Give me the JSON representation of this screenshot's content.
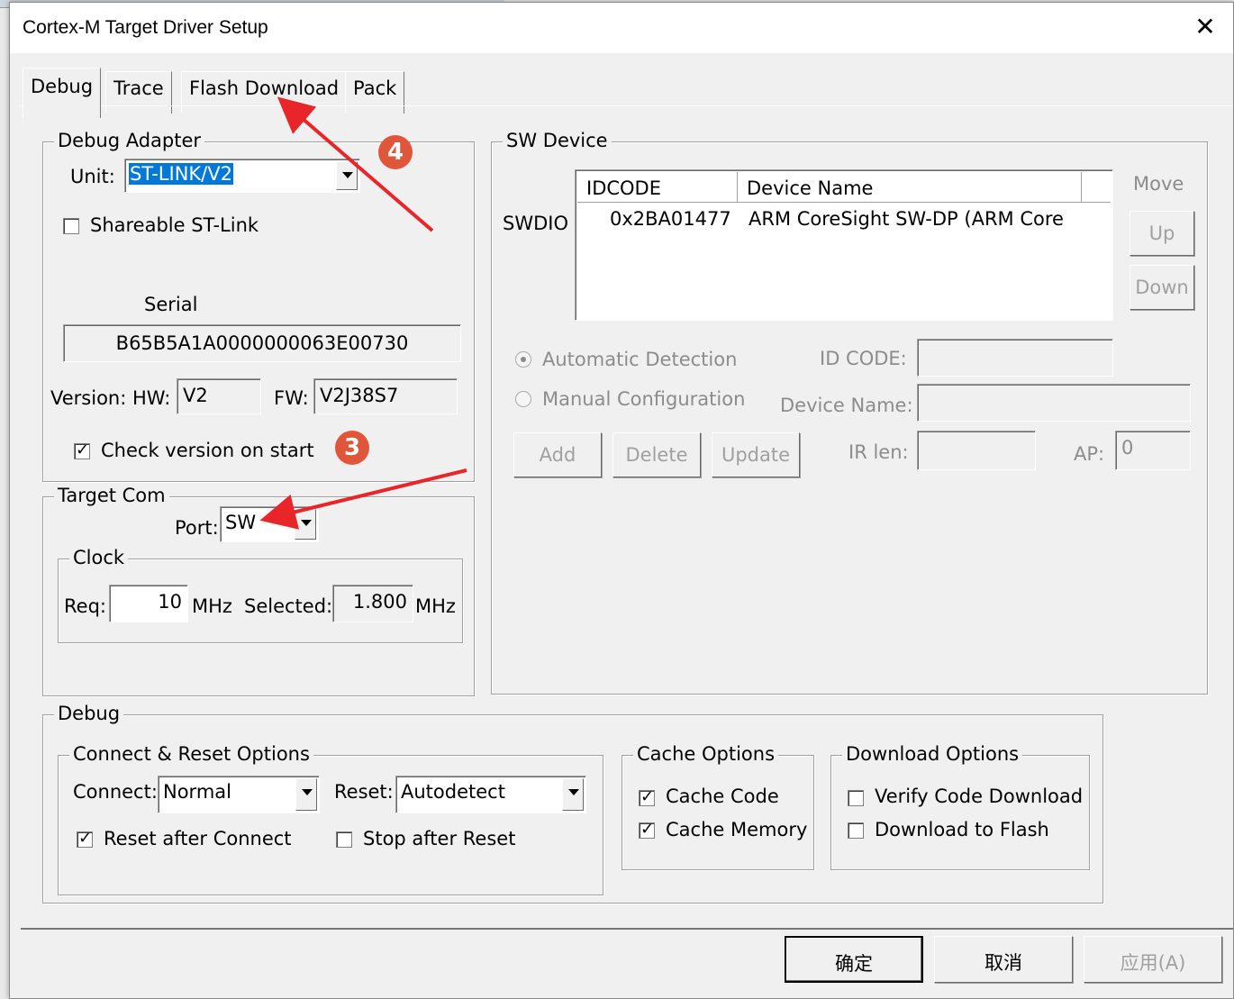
{
  "window": {
    "title": "Cortex-M Target Driver Setup"
  },
  "tabs": [
    {
      "label": "Debug",
      "active": true
    },
    {
      "label": "Trace",
      "active": false
    },
    {
      "label": "Flash Download",
      "active": false
    },
    {
      "label": "Pack",
      "active": false
    }
  ],
  "debug_adapter": {
    "legend": "Debug Adapter",
    "unit_label": "Unit:",
    "unit_value": "ST-LINK/V2",
    "shareable_label": "Shareable ST-Link",
    "shareable_checked": false,
    "serial_label": "Serial",
    "serial_value": "B65B5A1A0000000063E00730",
    "version_label": "Version: HW:",
    "hw_value": "V2",
    "fw_label": "FW:",
    "fw_value": "V2J38S7",
    "check_version_label": "Check version on start",
    "check_version_checked": true
  },
  "target_com": {
    "legend": "Target Com",
    "port_label": "Port:",
    "port_value": "SW",
    "clock": {
      "legend": "Clock",
      "req_label": "Req:",
      "req_value": "10",
      "req_unit": "MHz",
      "selected_label": "Selected:",
      "selected_value": "1.800",
      "selected_unit": "MHz"
    }
  },
  "sw_device": {
    "legend": "SW Device",
    "row_label": "SWDIO",
    "columns": [
      "IDCODE",
      "Device Name"
    ],
    "rows": [
      {
        "idcode": "0x2BA01477",
        "device_name": "ARM CoreSight SW-DP (ARM Core"
      }
    ],
    "move_label": "Move",
    "up_label": "Up",
    "down_label": "Down",
    "auto_detection_label": "Automatic Detection",
    "manual_config_label": "Manual Configuration",
    "id_code_label": "ID CODE:",
    "device_name_label": "Device Name:",
    "add_label": "Add",
    "delete_label": "Delete",
    "update_label": "Update",
    "ir_len_label": "IR len:",
    "ap_label": "AP:",
    "ap_value": "0"
  },
  "debug": {
    "legend": "Debug",
    "connect_reset": {
      "legend": "Connect & Reset Options",
      "connect_label": "Connect:",
      "connect_value": "Normal",
      "reset_label": "Reset:",
      "reset_value": "Autodetect",
      "reset_after_connect_label": "Reset after Connect",
      "reset_after_connect_checked": true,
      "stop_after_reset_label": "Stop after Reset",
      "stop_after_reset_checked": false
    },
    "cache_options": {
      "legend": "Cache Options",
      "cache_code_label": "Cache Code",
      "cache_code_checked": true,
      "cache_memory_label": "Cache Memory",
      "cache_memory_checked": true
    },
    "download_options": {
      "legend": "Download Options",
      "verify_label": "Verify Code Download",
      "verify_checked": false,
      "download_flash_label": "Download to Flash",
      "download_flash_checked": false
    }
  },
  "footer": {
    "ok_label": "确定",
    "cancel_label": "取消",
    "apply_label": "应用(A)"
  },
  "annotations": {
    "marker_3": "3",
    "marker_4": "4",
    "arrow_color": "#e8262a",
    "marker_color": "#e0563b"
  }
}
